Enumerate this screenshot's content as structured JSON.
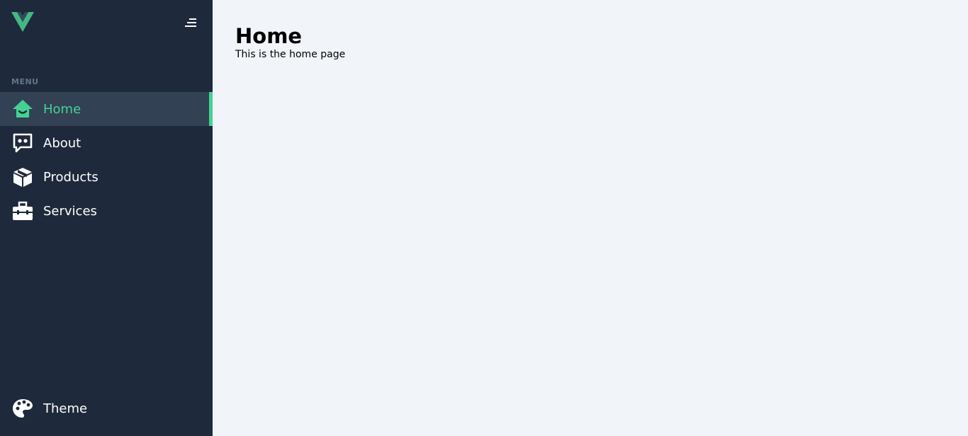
{
  "sidebar": {
    "menu_label": "MENU",
    "accent_color": "#42d392",
    "items": [
      {
        "label": "Home",
        "icon": "home-icon",
        "active": true
      },
      {
        "label": "About",
        "icon": "chat-icon",
        "active": false
      },
      {
        "label": "Products",
        "icon": "box-icon",
        "active": false
      },
      {
        "label": "Services",
        "icon": "briefcase-icon",
        "active": false
      }
    ],
    "theme": {
      "label": "Theme",
      "icon": "palette-icon"
    }
  },
  "main": {
    "title": "Home",
    "subtitle": "This is the home page"
  }
}
